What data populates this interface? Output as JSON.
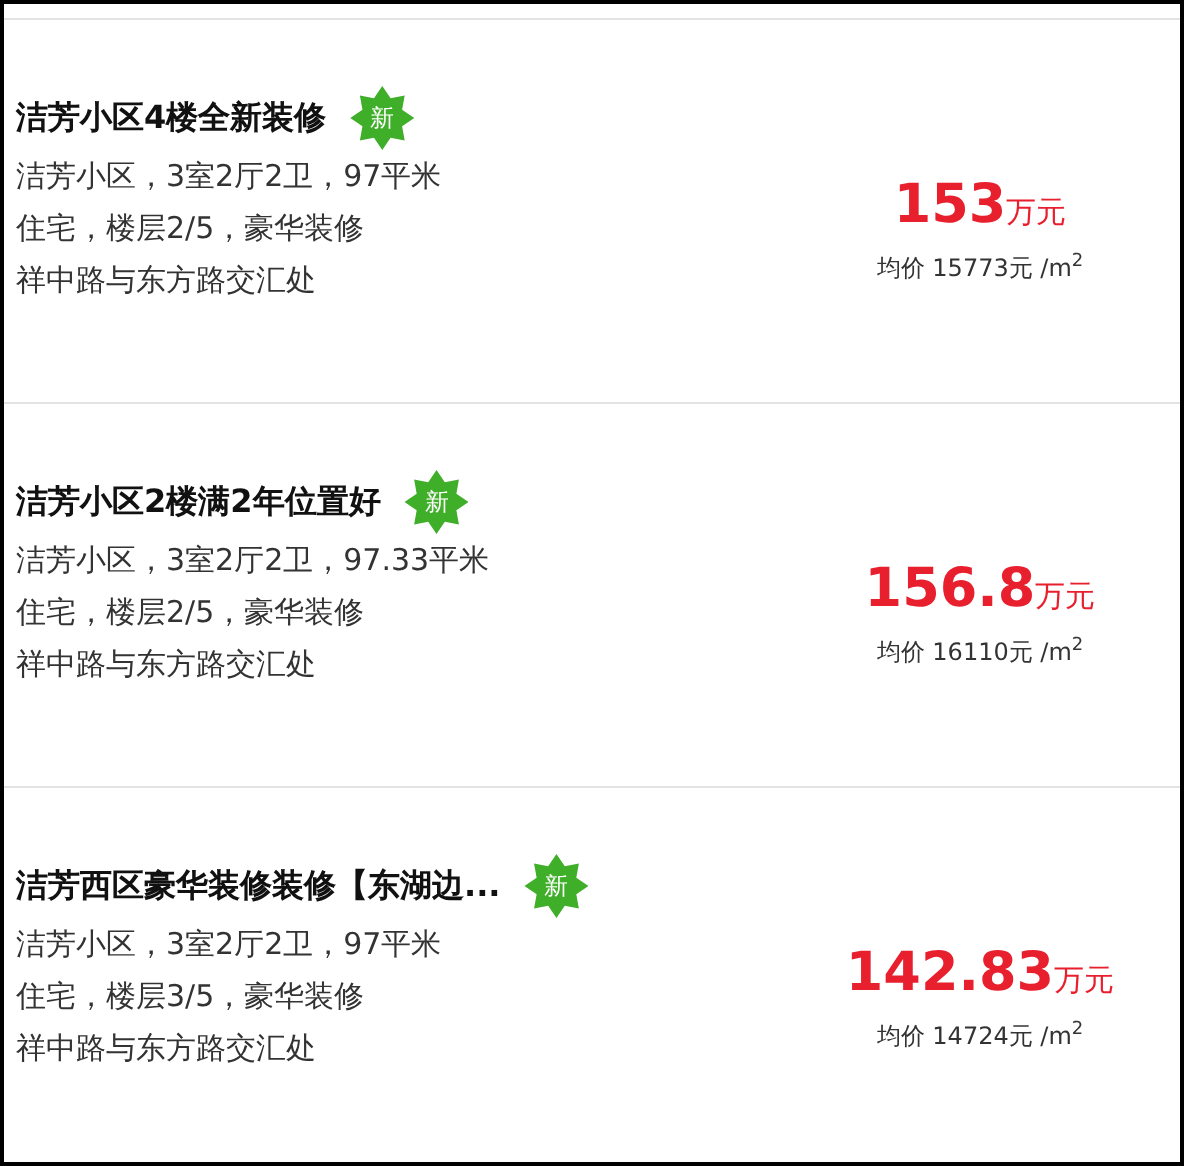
{
  "listings": [
    {
      "title": "洁芳小区4楼全新装修",
      "badge": "新",
      "details": [
        "洁芳小区，3室2厅2卫，97平米",
        "住宅，楼层2/5，豪华装修",
        "祥中路与东方路交汇处"
      ],
      "price": "153",
      "price_unit": "万元",
      "unit_price": "均价 15773元 /m$^{2}$"
    },
    {
      "title": "洁芳小区2楼满2年位置好",
      "badge": "新",
      "details": [
        "洁芳小区，3室2厅2卫，97.33平米",
        "住宅，楼层2/5，豪华装修",
        "祥中路与东方路交汇处"
      ],
      "price": "156.8",
      "price_unit": "万元",
      "unit_price": "均价 16110元 /m$^{2}$"
    },
    {
      "title": "洁芳西区豪华装修装修【东湖边...",
      "badge": "新",
      "details": [
        "洁芳小区，3室2厅2卫，97平米",
        "住宅，楼层3/5，豪华装修",
        "祥中路与东方路交汇处"
      ],
      "price": "142.83",
      "price_unit": "万元",
      "unit_price": "均价 14724元 /m$^{2}$"
    }
  ]
}
